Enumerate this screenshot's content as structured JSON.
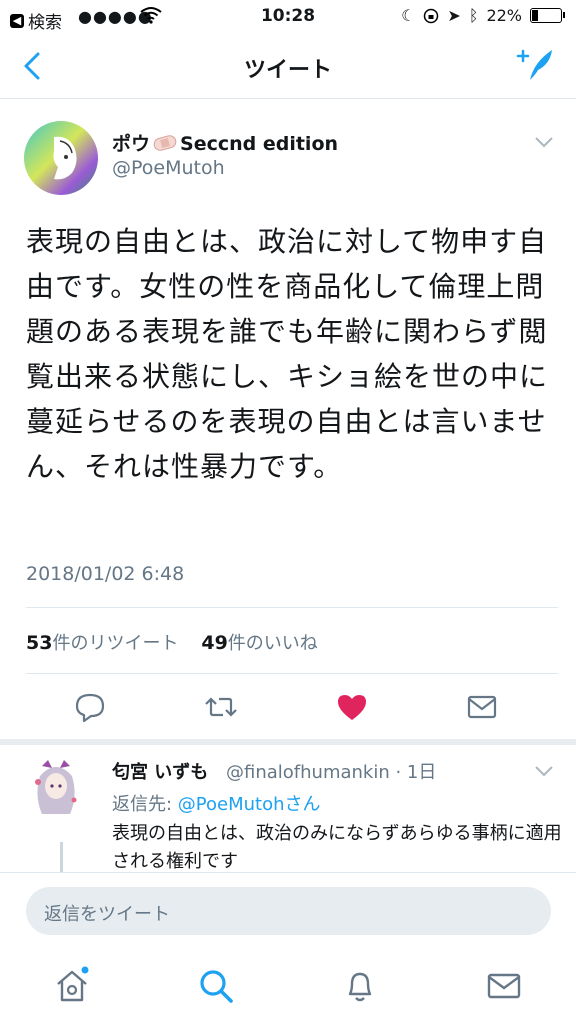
{
  "status": {
    "back_label": "検索",
    "signal": "●●●●●",
    "time": "10:28",
    "battery": "22%"
  },
  "nav": {
    "title": "ツイート"
  },
  "tweet": {
    "display_name": "ポウ",
    "name_suffix": "Seccnd edition",
    "handle": "@PoeMutoh",
    "text": "表現の自由とは、政治に対して物申す自由です。女性の性を商品化して倫理上問題のある表現を誰でも年齢に関わらず閲覧出来る状態にし、キショ絵を世の中に蔓延らせるのを表現の自由とは言いません、それは性暴力です。",
    "date": "2018/01/02 6:48",
    "retweet_count": "53",
    "retweet_label": "件のリツイート",
    "like_count": "49",
    "like_label": "件のいいね",
    "liked": true
  },
  "reply": {
    "display_name": "匂宮 いずも",
    "handle_time": "@finalofhumankin · 1日",
    "reply_to_prefix": "返信先: ",
    "reply_to_link": "@PoeMutohさん",
    "text": "表現の自由とは、政治のみにならずあらゆる事柄に適用される権利です"
  },
  "reply_bar": {
    "placeholder": "返信をツイート"
  },
  "colors": {
    "accent": "#1da1f2",
    "like": "#e0245e",
    "muted": "#657786"
  },
  "icons": [
    "back-chevron-icon",
    "compose-tweet-icon",
    "reply-icon",
    "retweet-icon",
    "like-heart-icon",
    "dm-mail-icon",
    "home-icon",
    "search-icon",
    "notifications-bell-icon",
    "messages-mail-icon"
  ]
}
